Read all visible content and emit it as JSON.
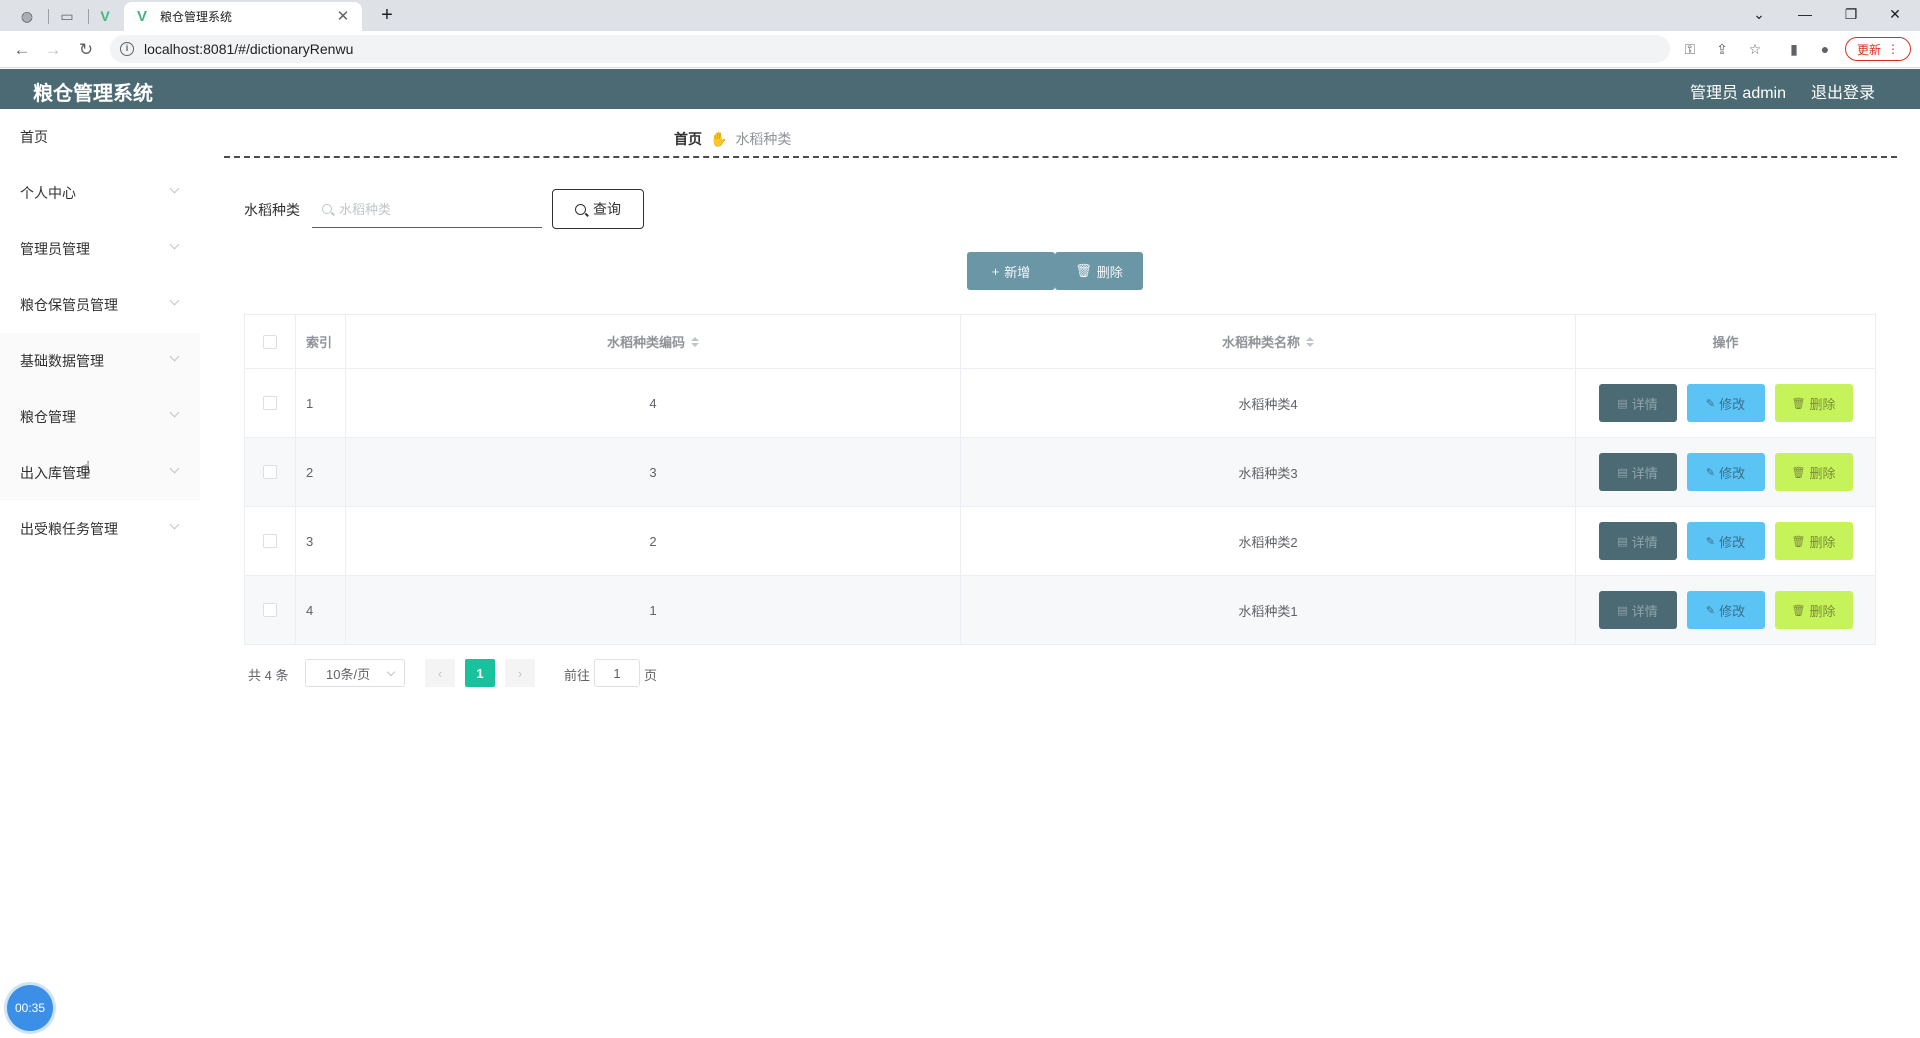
{
  "browser": {
    "tab_title": "粮仓管理系统",
    "url": "localhost:8081/#/dictionaryRenwu",
    "update_label": "更新"
  },
  "header": {
    "app_title": "粮仓管理系统",
    "admin_label": "管理员 admin",
    "logout_label": "退出登录"
  },
  "sidebar": {
    "items": [
      {
        "label": "首页",
        "has_children": false
      },
      {
        "label": "个人中心",
        "has_children": true
      },
      {
        "label": "管理员管理",
        "has_children": true
      },
      {
        "label": "粮仓保管员管理",
        "has_children": true
      },
      {
        "label": "基础数据管理",
        "has_children": true
      },
      {
        "label": "粮仓管理",
        "has_children": true
      },
      {
        "label": "出入库管理",
        "has_children": true
      },
      {
        "label": "出受粮任务管理",
        "has_children": true
      }
    ]
  },
  "breadcrumb": {
    "home": "首页",
    "current": "水稻种类"
  },
  "search": {
    "label": "水稻种类",
    "placeholder": "水稻种类",
    "query_button": "查询"
  },
  "actions": {
    "add_label": "新增",
    "delete_label": "删除"
  },
  "table": {
    "headers": {
      "index": "索引",
      "code": "水稻种类编码",
      "name": "水稻种类名称",
      "ops": "操作"
    },
    "rows": [
      {
        "index": "1",
        "code": "4",
        "name": "水稻种类4"
      },
      {
        "index": "2",
        "code": "3",
        "name": "水稻种类3"
      },
      {
        "index": "3",
        "code": "2",
        "name": "水稻种类2"
      },
      {
        "index": "4",
        "code": "1",
        "name": "水稻种类1"
      }
    ],
    "op_labels": {
      "detail": "详情",
      "edit": "修改",
      "delete": "删除"
    }
  },
  "pagination": {
    "total_text": "共 4 条",
    "page_size": "10条/页",
    "current_page": "1",
    "goto_label": "前往",
    "goto_value": "1",
    "page_suffix": "页"
  },
  "timer": "00:35",
  "colors": {
    "header_bg": "#4b6a74",
    "primary_btn": "#6a96a6",
    "detail_btn": "#4b6a74",
    "edit_btn": "#5cc4f5",
    "delete_btn": "#c7f35a",
    "page_active": "#17c29c"
  }
}
